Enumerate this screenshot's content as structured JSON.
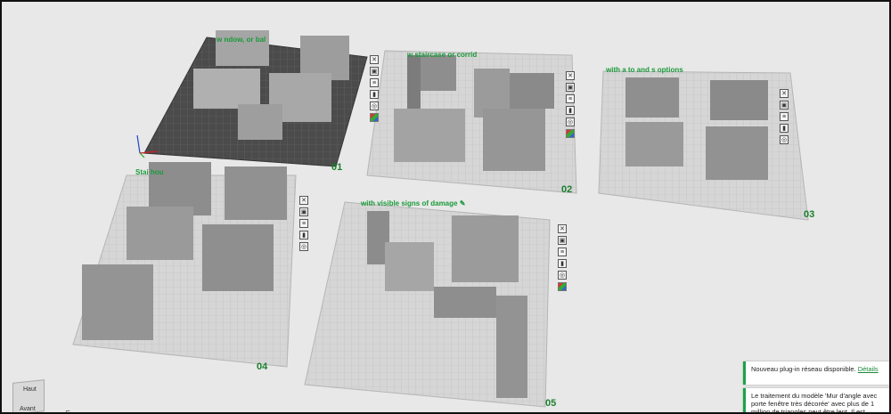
{
  "plates": [
    {
      "number": "01",
      "caption": "with a window, or balcony",
      "caption_visible": "w          ndow, or bal"
    },
    {
      "number": "02",
      "caption": "with a staircase or corridor",
      "caption_visible": "w         staircase or corrid"
    },
    {
      "number": "03",
      "caption": "with a tower and options",
      "caption_visible": "with a to       and       s options"
    },
    {
      "number": "04",
      "caption": "Stairs house",
      "caption_visible": "Stai              hou"
    },
    {
      "number": "05",
      "caption": "with visible signs of damage",
      "caption_visible": "with visible signs of damage ✎"
    }
  ],
  "plate_tools": [
    "close-icon",
    "image-icon",
    "stack-icon",
    "lock-icon",
    "settings-icon",
    "color-icon"
  ],
  "notifications": {
    "plugin": {
      "text": "Nouveau plug-in réseau disponible.",
      "link": "Détails"
    },
    "warning": {
      "text": "Le traitement du modèle 'Mur d'angle avec porte fenêtre très décorée' avec plus de 1 million de triangles peut être lent. Il est fortement recom"
    }
  },
  "nav_cube": {
    "top_label": "Haut",
    "front_label": "Avant"
  },
  "colors": {
    "accent": "#1a9a3a",
    "plate_bg": "#cfcfcf",
    "active_plate": "#4a4a4a",
    "model_gray": "#9a9a9a"
  }
}
